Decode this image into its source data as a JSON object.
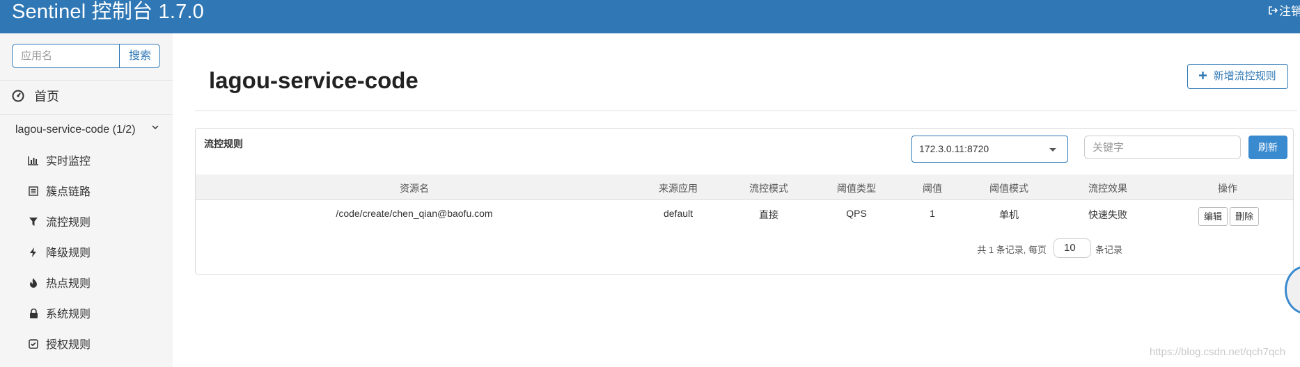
{
  "header": {
    "title": "Sentinel 控制台 1.7.0",
    "logout_label": "注销"
  },
  "sidebar": {
    "search_placeholder": "应用名",
    "search_button": "搜索",
    "home_label": "首页",
    "app_label": "lagou-service-code  (1/2)",
    "items": [
      {
        "label": "实时监控",
        "icon": "bar-chart-icon"
      },
      {
        "label": "簇点链路",
        "icon": "list-icon"
      },
      {
        "label": "流控规则",
        "icon": "filter-icon"
      },
      {
        "label": "降级规则",
        "icon": "flash-icon"
      },
      {
        "label": "热点规则",
        "icon": "fire-icon"
      },
      {
        "label": "系统规则",
        "icon": "lock-icon"
      },
      {
        "label": "授权规则",
        "icon": "check-square-icon"
      }
    ]
  },
  "main": {
    "page_title": "lagou-service-code",
    "add_button": "新增流控规则",
    "panel_title": "流控规则",
    "machine_select": "172.3.0.11:8720",
    "keyword_placeholder": "关键字",
    "refresh_button": "刷新",
    "table": {
      "headers": [
        "资源名",
        "来源应用",
        "流控模式",
        "阈值类型",
        "阈值",
        "阈值模式",
        "流控效果",
        "操作"
      ],
      "rows": [
        {
          "resource": "/code/create/chen_qian@baofu.com",
          "origin": "default",
          "mode": "直接",
          "grade": "QPS",
          "threshold": "1",
          "cluster_mode": "单机",
          "effect": "快速失败",
          "edit": "编辑",
          "delete": "删除"
        }
      ]
    },
    "pager": {
      "summary": "共 1 条记录, 每页",
      "page_size": "10",
      "suffix": "条记录"
    }
  },
  "watermark": "https://blog.csdn.net/qch7qch"
}
